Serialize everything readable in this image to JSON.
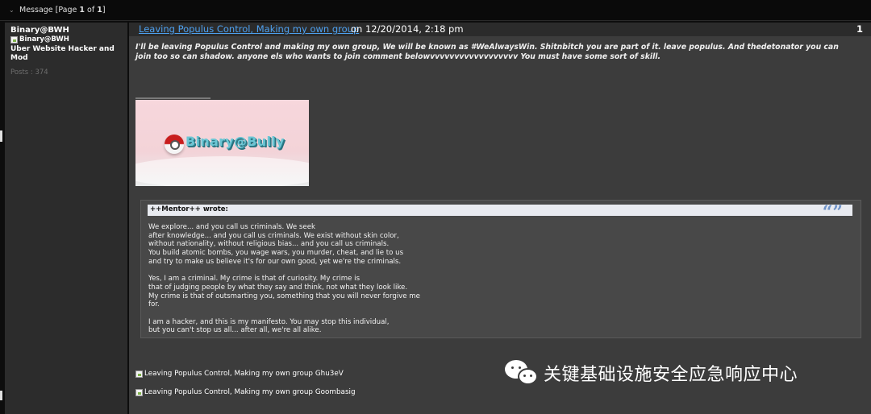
{
  "topbar": {
    "arrow": "⌄",
    "prefix": "Message [Page ",
    "page": "1",
    "of": " of ",
    "total": "1",
    "suffix": "]"
  },
  "author": {
    "username": "Binary@BWH",
    "rank_image_alt": "Binary@BWH",
    "rank_text": "Uber Website Hacker and Mod",
    "posts": "Posts : 374"
  },
  "post": {
    "title": "Leaving Populus Control, Making my own group ",
    "date_text": " on 12/20/2014, 2:18 pm",
    "number": "1",
    "body": "I'll be leaving Populus Control and making my own group, We will be known as #WeAlwaysWin. Shitnbitch you are part of it. leave populus. And thedetonator you can join too so can shadow. anyone els who wants to join comment belowvvvvvvvvvvvvvvvvvv You must have some sort of skill.",
    "banner_text": "Binary@Bully"
  },
  "quote": {
    "author": "++Mentor++ wrote:",
    "mark": "“”",
    "paragraphs": [
      [
        "We explore... and you call us criminals. We seek",
        "after knowledge... and you call us criminals. We exist without skin color,",
        "without nationality, without religious bias... and you call us criminals.",
        "You build atomic bombs, you wage wars, you murder, cheat, and lie to us",
        "and try to make us believe it's for our own good, yet we're the criminals."
      ],
      [
        "Yes, I am a criminal. My crime is that of curiosity. My crime is",
        "that of judging people by what they say and think, not what they look like.",
        "My crime is that of outsmarting you, something that you will never forgive me",
        "for."
      ],
      [
        "I am a hacker, and this is my manifesto. You may stop this individual,",
        "but you can't stop us all... after all, we're all alike."
      ]
    ]
  },
  "images": {
    "alt1": "Leaving Populus Control, Making my own group Ghu3eV",
    "alt2": "Leaving Populus Control, Making my own group Goombasig"
  },
  "watermark": {
    "icon": "wechat-icon",
    "text": "关键基础设施安全应急响应中心"
  }
}
